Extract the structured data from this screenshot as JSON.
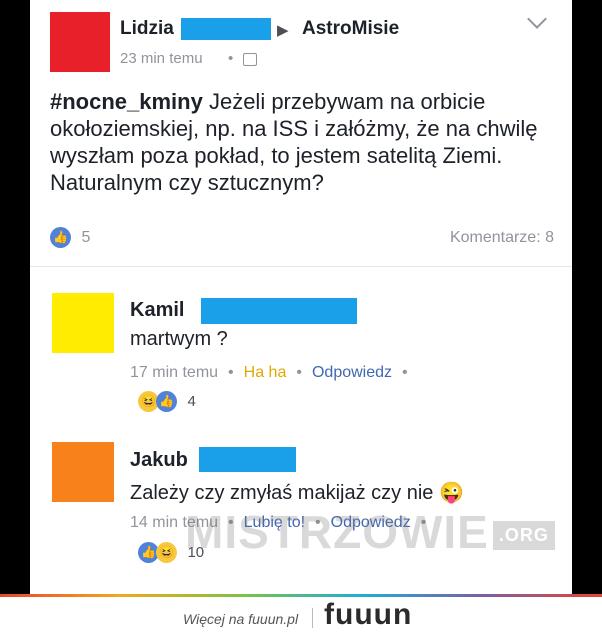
{
  "post": {
    "author": "Lidzia",
    "arrow": "▶",
    "group": "AstroMisie",
    "time": "23 min temu",
    "separator": "•",
    "privacy_icon": "group-icon",
    "hashtag": "#nocne_kminy",
    "text": " Jeżeli przebywam na orbicie okołoziemskiej, np. na ISS i załóżmy, że na chwilę wyszłam poza pokład, to jestem satelitą Ziemi. Naturalnym czy sztucznym?",
    "like_count": "5",
    "comments_label": "Komentarze: 8",
    "avatar_color": "#e8202a"
  },
  "comments": [
    {
      "name": "Kamil",
      "text": "martwym ?",
      "time": "17 min temu",
      "reaction_label": "Ha ha",
      "reply_label": "Odpowiedz",
      "reaction_count": "4",
      "avatar_color": "#ffec00"
    },
    {
      "name": "Jakub",
      "text": "Zależy czy zmyłaś makijaż czy nie",
      "emoji": "😜",
      "time": "14 min temu",
      "like_label": "Lubię to!",
      "reply_label": "Odpowiedz",
      "reaction_count": "10",
      "avatar_color": "#f7821c"
    }
  ],
  "watermark": {
    "text": "MISTRZOWIE",
    "suffix": ".ORG"
  },
  "footer": {
    "text": "Więcej na fuuun.pl",
    "logo": "fuuun"
  },
  "colors": {
    "redacted_bar": "#1aa0e8",
    "link": "#4267b2"
  }
}
